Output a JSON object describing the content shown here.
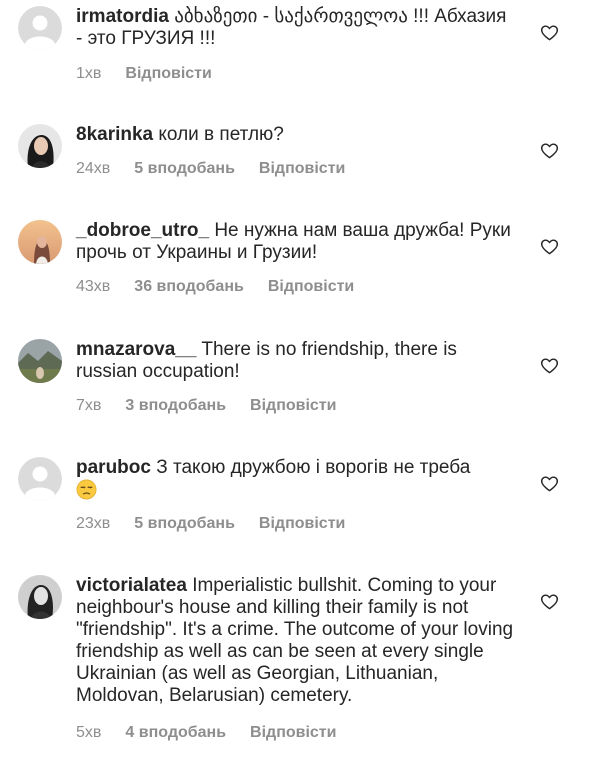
{
  "comments": [
    {
      "username": "irmatordia",
      "text": "აბხაზეთი - საქართველოა !!! Абхазия - это  ГРУЗИЯ !!!",
      "time": "1хв",
      "likes": "",
      "reply": "Відповісти",
      "avatar": "default-avatar-icon"
    },
    {
      "username": "8karinka",
      "text": "коли в петлю?",
      "time": "24хв",
      "likes": "5 вподобань",
      "reply": "Відповісти",
      "avatar": "dark-haired-woman-avatar"
    },
    {
      "username": "_dobroe_utro_",
      "text": "Не нужна нам ваша дружба! Руки прочь от Украины и Грузии!",
      "time": "43хв",
      "likes": "36 вподобань",
      "reply": "Відповісти",
      "avatar": "sunset-portrait-avatar"
    },
    {
      "username": "mnazarova__",
      "text": "There is no friendship, there is russian occupation!",
      "time": "7хв",
      "likes": "3 вподобань",
      "reply": "Відповісти",
      "avatar": "landscape-person-avatar"
    },
    {
      "username": "paruboc",
      "text": "З такою дружбою і ворогів не треба",
      "emoji": "unamused-face-emoji",
      "time": "23хв",
      "likes": "5 вподобань",
      "reply": "Відповісти",
      "avatar": "default-avatar-icon"
    },
    {
      "username": "victorialatea",
      "text": "Imperialistic bullshit. Coming to your neighbour's house and killing their family is not \"friendship\". It's a crime. The outcome of your loving friendship as well as can be seen at every single Ukrainian (as well as Georgian, Lithuanian, Moldovan, Belarusian) cemetery.",
      "time": "5хв",
      "likes": "4 вподобань",
      "reply": "Відповісти",
      "avatar": "black-white-portrait-avatar"
    }
  ],
  "icons": {
    "like": "heart-outline-icon"
  },
  "colors": {
    "text": "#262626",
    "meta": "#8e8e8e",
    "heart": "#262626"
  }
}
